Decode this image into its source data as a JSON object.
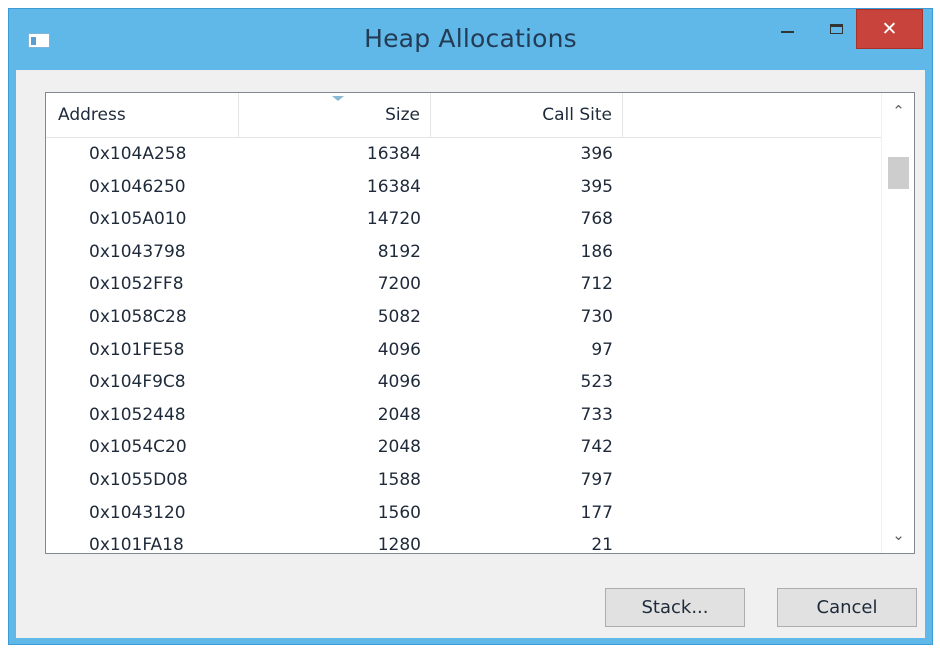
{
  "window": {
    "title": "Heap Allocations"
  },
  "titlebar": {
    "close_glyph": "✕"
  },
  "table": {
    "columns": [
      "Address",
      "Size",
      "Call Site"
    ],
    "sort_column": "Size",
    "sort_direction": "descending",
    "rows": [
      {
        "address": "0x104A258",
        "size": "16384",
        "call_site": "396"
      },
      {
        "address": "0x1046250",
        "size": "16384",
        "call_site": "395"
      },
      {
        "address": "0x105A010",
        "size": "14720",
        "call_site": "768"
      },
      {
        "address": "0x1043798",
        "size": "8192",
        "call_site": "186"
      },
      {
        "address": "0x1052FF8",
        "size": "7200",
        "call_site": "712"
      },
      {
        "address": "0x1058C28",
        "size": "5082",
        "call_site": "730"
      },
      {
        "address": "0x101FE58",
        "size": "4096",
        "call_site": "97"
      },
      {
        "address": "0x104F9C8",
        "size": "4096",
        "call_site": "523"
      },
      {
        "address": "0x1052448",
        "size": "2048",
        "call_site": "733"
      },
      {
        "address": "0x1054C20",
        "size": "2048",
        "call_site": "742"
      },
      {
        "address": "0x1055D08",
        "size": "1588",
        "call_site": "797"
      },
      {
        "address": "0x1043120",
        "size": "1560",
        "call_site": "177"
      },
      {
        "address": "0x101FA18",
        "size": "1280",
        "call_site": "21"
      }
    ]
  },
  "scrollbar": {
    "up_glyph": "⌃",
    "down_glyph": "⌄"
  },
  "buttons": {
    "stack_label": "Stack...",
    "cancel_label": "Cancel"
  },
  "colors": {
    "titlebar": "#5fb8e8",
    "close_button": "#c7433c",
    "dialog_background": "#f0f0f0",
    "sort_indicator": "#8ab9d8"
  }
}
